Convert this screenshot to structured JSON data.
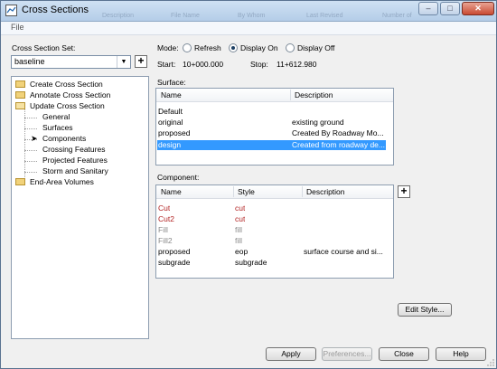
{
  "window": {
    "title": "Cross Sections"
  },
  "background_headers": [
    "Description",
    "File Name",
    "By Whom",
    "Last Revised",
    "Number of"
  ],
  "menu": {
    "file": "File"
  },
  "set": {
    "label": "Cross Section Set:",
    "value": "baseline"
  },
  "tree": {
    "items": [
      {
        "label": "Create Cross Section",
        "type": "folder"
      },
      {
        "label": "Annotate Cross Section",
        "type": "folder"
      },
      {
        "label": "Update Cross Section",
        "type": "folder-open"
      },
      {
        "label": "General",
        "type": "leaf"
      },
      {
        "label": "Surfaces",
        "type": "leaf"
      },
      {
        "label": "Components",
        "type": "leaf-active"
      },
      {
        "label": "Crossing Features",
        "type": "leaf"
      },
      {
        "label": "Projected Features",
        "type": "leaf"
      },
      {
        "label": "Storm and Sanitary",
        "type": "leaf"
      },
      {
        "label": "End-Area Volumes",
        "type": "folder"
      }
    ]
  },
  "mode": {
    "label": "Mode:",
    "options": [
      "Refresh",
      "Display On",
      "Display Off"
    ],
    "selected": "Display On"
  },
  "range": {
    "start_label": "Start:",
    "start": "10+000.000",
    "stop_label": "Stop:",
    "stop": "11+612.980"
  },
  "surface": {
    "label": "Surface:",
    "columns": [
      "Name",
      "Description"
    ],
    "rows": [
      {
        "name": "Default",
        "description": ""
      },
      {
        "name": "original",
        "description": "existing ground"
      },
      {
        "name": "proposed",
        "description": "Created By Roadway Mo..."
      },
      {
        "name": "design",
        "description": "Created from roadway de...",
        "selected": true
      }
    ]
  },
  "component": {
    "label": "Component:",
    "columns": [
      "Name",
      "Style",
      "Description"
    ],
    "rows": [
      {
        "name": "Cut",
        "style": "cut",
        "description": "",
        "color": "#b22222"
      },
      {
        "name": "Cut2",
        "style": "cut",
        "description": "",
        "color": "#b22222"
      },
      {
        "name": "Fill",
        "style": "fill",
        "description": "",
        "color": "#8a8a8a"
      },
      {
        "name": "Fill2",
        "style": "fill",
        "description": "",
        "color": "#8a8a8a"
      },
      {
        "name": "proposed",
        "style": "eop",
        "description": "surface course and si...",
        "color": "#000000"
      },
      {
        "name": "subgrade",
        "style": "subgrade",
        "description": "",
        "color": "#000000"
      }
    ]
  },
  "buttons": {
    "edit_style": "Edit Style...",
    "apply": "Apply",
    "preferences": "Preferences...",
    "close": "Close",
    "help": "Help"
  },
  "colors": {
    "selection": "#3399ff",
    "titlebar": "#b4cde8"
  }
}
